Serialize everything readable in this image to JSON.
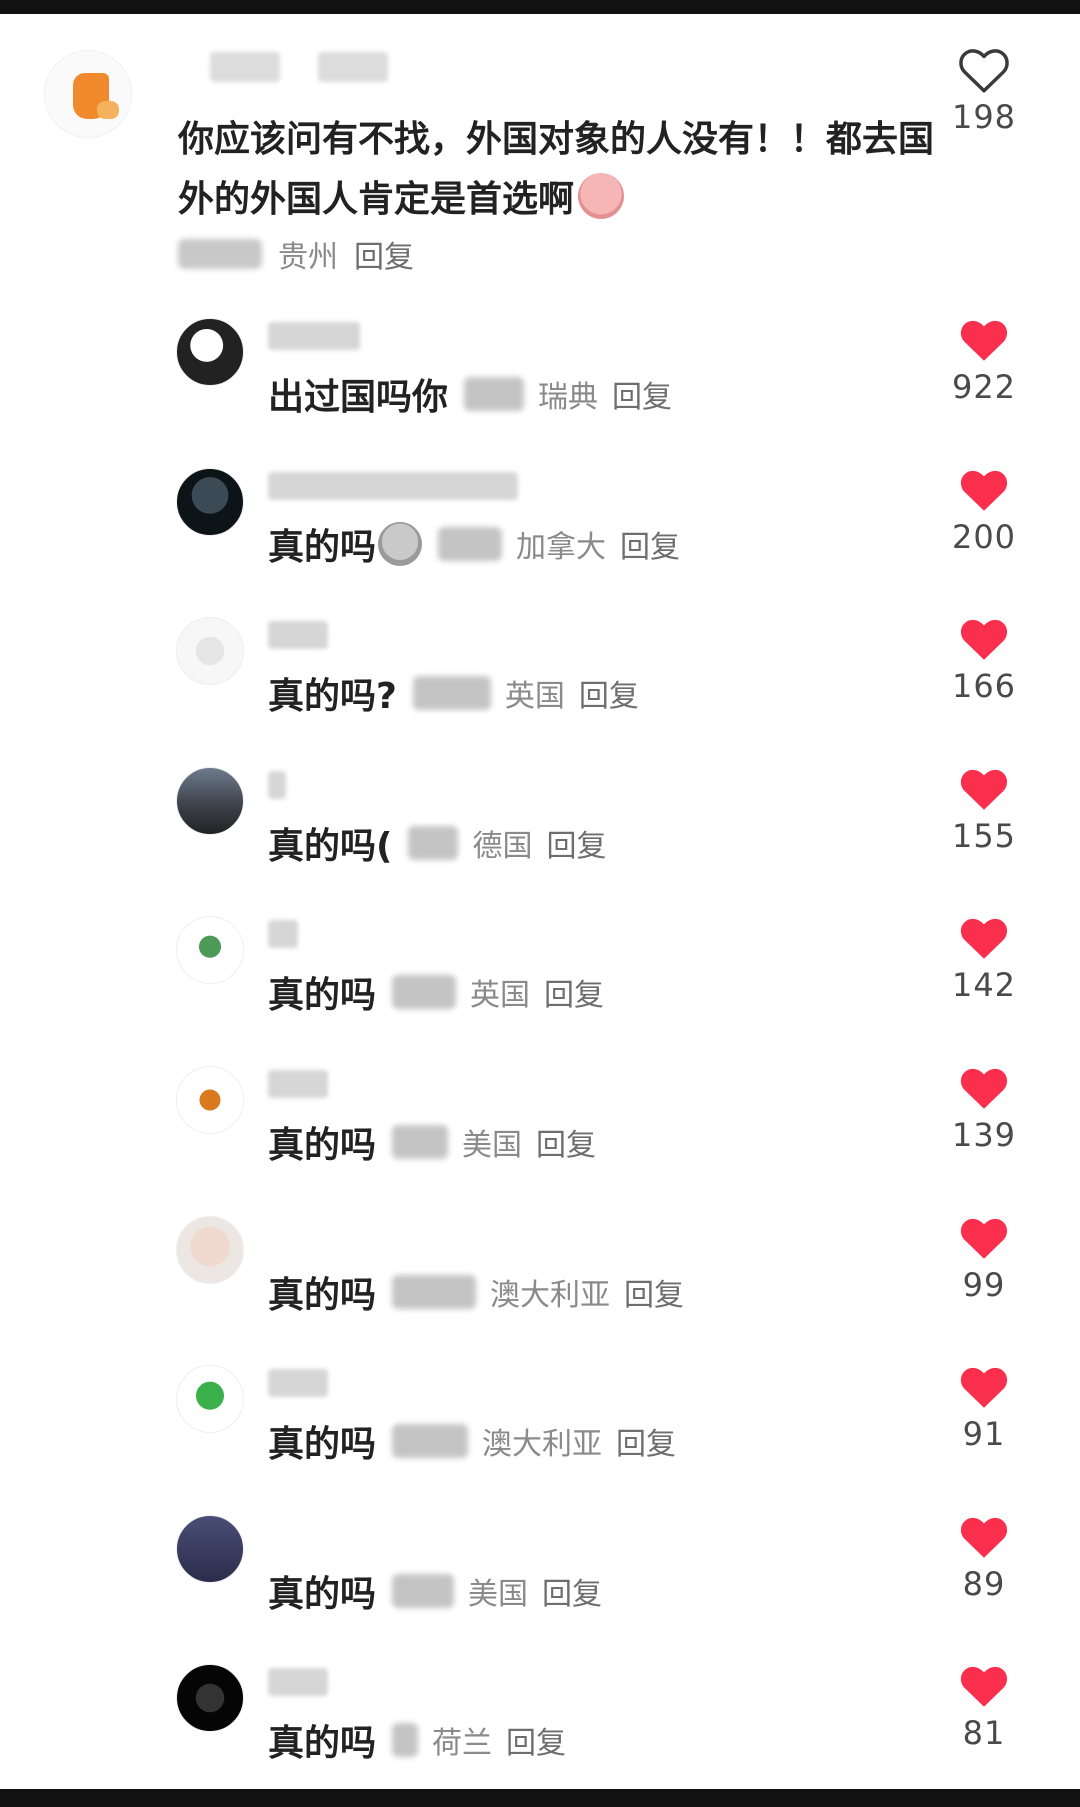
{
  "colors": {
    "heart_filled": "#fa2e4d",
    "text_primary": "#222222",
    "text_secondary": "#8a8a8a"
  },
  "main_comment": {
    "text": "你应该问有不找，外国对象的人没有！！都去国外的外国人肯定是首选啊",
    "location": "贵州",
    "reply_label": "回复",
    "like_count": "198",
    "liked": false,
    "icon": "heart-outline-icon"
  },
  "replies": [
    {
      "text": "出过国吗你",
      "location": "瑞典",
      "reply_label": "回复",
      "like_count": "922",
      "avatar": "anime-girl-avatar"
    },
    {
      "text": "真的吗",
      "location": "加拿大",
      "reply_label": "回复",
      "like_count": "200",
      "avatar": "dark-figure-avatar"
    },
    {
      "text": "真的吗?",
      "location": "英国",
      "reply_label": "回复",
      "like_count": "166",
      "avatar": "white-bag-avatar"
    },
    {
      "text": "真的吗(",
      "location": "德国",
      "reply_label": "回复",
      "like_count": "155",
      "avatar": "building-avatar"
    },
    {
      "text": "真的吗",
      "location": "英国",
      "reply_label": "回复",
      "like_count": "142",
      "avatar": "broccoli-avatar"
    },
    {
      "text": "真的吗",
      "location": "美国",
      "reply_label": "回复",
      "like_count": "139",
      "avatar": "burger-avatar"
    },
    {
      "text": "真的吗",
      "location": "澳大利亚",
      "reply_label": "回复",
      "like_count": "99",
      "avatar": "anime-boy-avatar"
    },
    {
      "text": "真的吗",
      "location": "澳大利亚",
      "reply_label": "回复",
      "like_count": "91",
      "avatar": "broccoli-green-avatar"
    },
    {
      "text": "真的吗",
      "location": "美国",
      "reply_label": "回复",
      "like_count": "89",
      "avatar": "night-sky-avatar"
    },
    {
      "text": "真的吗",
      "location": "荷兰",
      "reply_label": "回复",
      "like_count": "81",
      "avatar": "dark-scene-avatar"
    }
  ]
}
